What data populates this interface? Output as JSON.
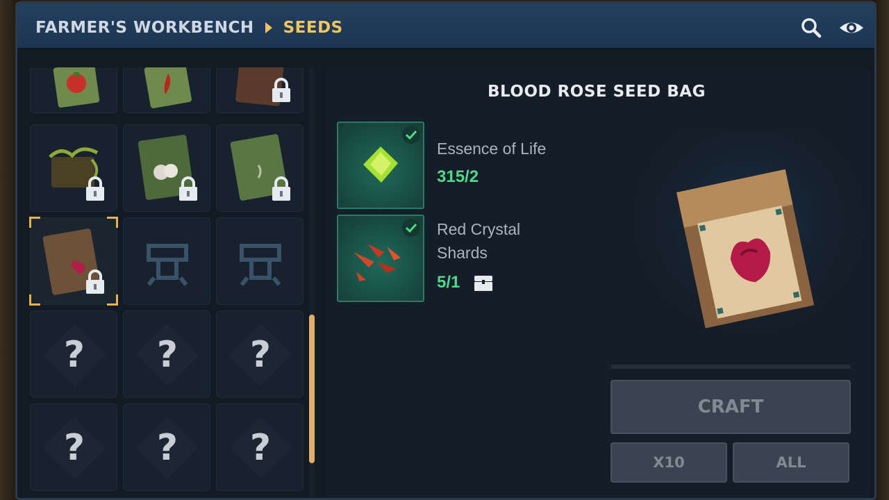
{
  "header": {
    "parent_label": "FARMER'S WORKBENCH",
    "current_label": "SEEDS",
    "search_icon": "search-icon",
    "visibility_icon": "eye-icon"
  },
  "grid": {
    "unknown_label": "?",
    "slots": [
      {
        "item": "tomato-seed-bag",
        "locked": false
      },
      {
        "item": "pepper-seed-bag",
        "locked": false
      },
      {
        "item": "brown-seed-bag",
        "locked": true
      },
      {
        "item": "vine-seed-bag",
        "locked": true
      },
      {
        "item": "cotton-seed-bag",
        "locked": true
      },
      {
        "item": "green-seed-bag",
        "locked": true
      },
      {
        "item": "blood-rose-seed-bag",
        "locked": true,
        "selected": true
      },
      {
        "item": "workbench-emblem",
        "locked": false
      },
      {
        "item": "workbench-emblem",
        "locked": false
      },
      {
        "item": "unknown",
        "locked": false
      },
      {
        "item": "unknown",
        "locked": false
      },
      {
        "item": "unknown",
        "locked": false
      },
      {
        "item": "unknown",
        "locked": false
      },
      {
        "item": "unknown",
        "locked": false
      },
      {
        "item": "unknown",
        "locked": false
      }
    ]
  },
  "detail": {
    "title": "BLOOD ROSE SEED BAG",
    "ingredients": [
      {
        "name": "Essence of Life",
        "count": "315/2",
        "icon": "essence-of-life-icon",
        "satisfied": true
      },
      {
        "name_line1": "Red Crystal",
        "name_line2": "Shards",
        "count": "5/1",
        "icon": "red-crystal-shards-icon",
        "satisfied": true,
        "storage_icon": "chest-icon"
      }
    ],
    "craft_label": "CRAFT",
    "x10_label": "X10",
    "all_label": "ALL"
  },
  "colors": {
    "accent": "#f2c65e",
    "count_ok": "#4fd98a",
    "panel": "#151d28"
  }
}
